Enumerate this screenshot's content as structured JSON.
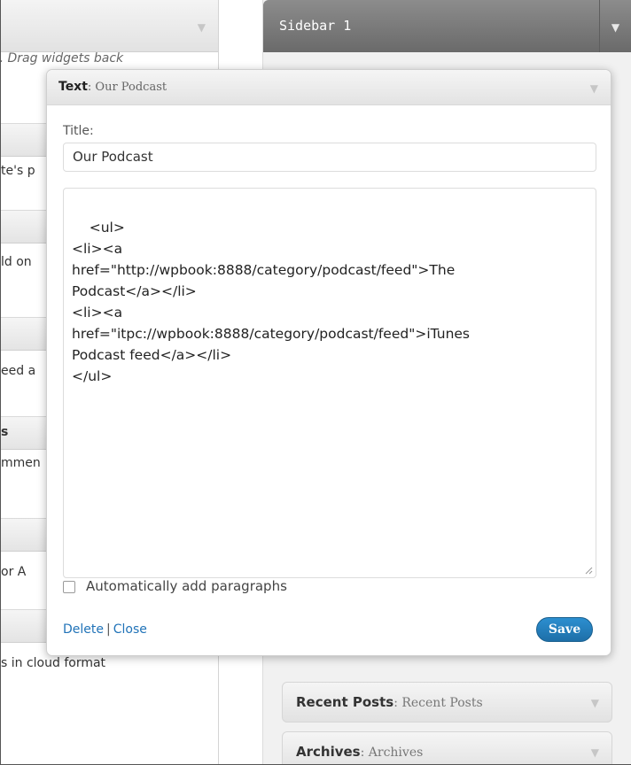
{
  "available_widgets": {
    "description": "a. Drag widgets back",
    "widget_descriptions": [
      "te's p",
      "ld on",
      "eed a",
      "mmen",
      "or A",
      "s in cloud format"
    ],
    "widget_titles": [
      "s"
    ]
  },
  "sidebar": {
    "title": "Sidebar 1"
  },
  "edit_widget": {
    "type": "Text",
    "name_suffix": ": Our Podcast",
    "title_label": "Title:",
    "title_value": "Our Podcast",
    "content": "<ul>\n<li><a\nhref=\"http://wpbook:8888/category/podcast/feed\">The\nPodcast</a></li>\n<li><a\nhref=\"itpc://wpbook:8888/category/podcast/feed\">iTunes\nPodcast feed</a></li>\n</ul>",
    "auto_paragraphs_label": "Automatically add paragraphs",
    "auto_paragraphs_checked": false,
    "delete_label": "Delete",
    "separator": "|",
    "close_label": "Close",
    "save_label": "Save"
  },
  "sidebar_widgets": [
    {
      "name": "Recent Posts",
      "sub": ": Recent Posts"
    },
    {
      "name": "Archives",
      "sub": ": Archives"
    }
  ],
  "colors": {
    "link": "#2173b8",
    "save_button": "#2481c0",
    "sidebar_header": "#7b7b7b"
  }
}
